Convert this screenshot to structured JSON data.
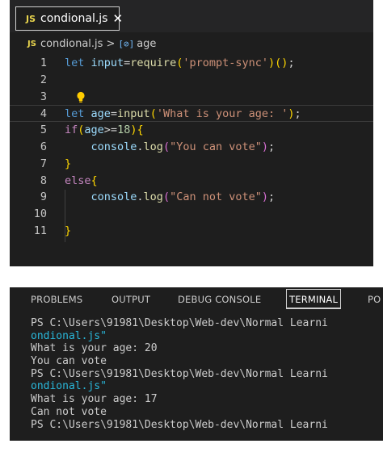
{
  "editor": {
    "tab": {
      "badge": "JS",
      "label": "condional.js",
      "close": "✕"
    },
    "breadcrumb": {
      "badge": "JS",
      "file": "condional.js",
      "separator": ">",
      "symbol_icon": "[⊘]",
      "symbol": "age"
    },
    "lines": [
      {
        "n": "1",
        "tokens": [
          {
            "t": "let ",
            "c": "kw"
          },
          {
            "t": "input",
            "c": "var"
          },
          {
            "t": "=",
            "c": ""
          },
          {
            "t": "require",
            "c": "fn"
          },
          {
            "t": "(",
            "c": "b1"
          },
          {
            "t": "'prompt-sync'",
            "c": "str"
          },
          {
            "t": ")",
            "c": "b1"
          },
          {
            "t": "(",
            "c": "b1"
          },
          {
            "t": ")",
            "c": "b1"
          },
          {
            "t": ";",
            "c": ""
          }
        ]
      },
      {
        "n": "2",
        "tokens": []
      },
      {
        "n": "3",
        "tokens": [],
        "bulb": true
      },
      {
        "n": "4",
        "tokens": [
          {
            "t": "let ",
            "c": "kw"
          },
          {
            "t": "age",
            "c": "var"
          },
          {
            "t": "=",
            "c": ""
          },
          {
            "t": "input",
            "c": "fn"
          },
          {
            "t": "(",
            "c": "b1"
          },
          {
            "t": "'What is your age: '",
            "c": "str"
          },
          {
            "t": ")",
            "c": "b1"
          },
          {
            "t": ";",
            "c": ""
          }
        ],
        "current": true
      },
      {
        "n": "5",
        "tokens": [
          {
            "t": "if",
            "c": "kw2"
          },
          {
            "t": "(",
            "c": "b1"
          },
          {
            "t": "age",
            "c": "var"
          },
          {
            "t": ">=",
            "c": ""
          },
          {
            "t": "18",
            "c": "num"
          },
          {
            "t": ")",
            "c": "b1"
          },
          {
            "t": "{",
            "c": "b1"
          }
        ]
      },
      {
        "n": "6",
        "tokens": [
          {
            "t": "    console",
            "c": "var"
          },
          {
            "t": ".",
            "c": ""
          },
          {
            "t": "log",
            "c": "fn"
          },
          {
            "t": "(",
            "c": "b2"
          },
          {
            "t": "\"You can vote\"",
            "c": "str"
          },
          {
            "t": ")",
            "c": "b2"
          },
          {
            "t": ";",
            "c": ""
          }
        ]
      },
      {
        "n": "7",
        "tokens": [
          {
            "t": "}",
            "c": "b1"
          }
        ]
      },
      {
        "n": "8",
        "tokens": [
          {
            "t": "else",
            "c": "kw2"
          },
          {
            "t": "{",
            "c": "b1"
          }
        ]
      },
      {
        "n": "9",
        "tokens": [
          {
            "t": "    console",
            "c": "var"
          },
          {
            "t": ".",
            "c": ""
          },
          {
            "t": "log",
            "c": "fn"
          },
          {
            "t": "(",
            "c": "b2"
          },
          {
            "t": "\"Can not vote\"",
            "c": "str"
          },
          {
            "t": ")",
            "c": "b2"
          },
          {
            "t": ";",
            "c": ""
          }
        ]
      },
      {
        "n": "10",
        "tokens": []
      },
      {
        "n": "11",
        "tokens": [
          {
            "t": "}",
            "c": "b1"
          }
        ]
      }
    ]
  },
  "terminal": {
    "tabs": {
      "problems": "PROBLEMS",
      "output": "OUTPUT",
      "debug_console": "DEBUG CONSOLE",
      "terminal": "TERMINAL",
      "ports": "PO"
    },
    "lines": [
      {
        "text": "PS C:\\Users\\91981\\Desktop\\Web-dev\\Normal Learni",
        "style": ""
      },
      {
        "text": "ondional.js\"",
        "style": "cyan"
      },
      {
        "text": "What is your age: 20",
        "style": ""
      },
      {
        "text": "You can vote",
        "style": ""
      },
      {
        "text": "PS C:\\Users\\91981\\Desktop\\Web-dev\\Normal Learni",
        "style": ""
      },
      {
        "text": "ondional.js\"",
        "style": "cyan"
      },
      {
        "text": "What is your age: 17",
        "style": ""
      },
      {
        "text": "Can not vote",
        "style": ""
      },
      {
        "text": "PS C:\\Users\\91981\\Desktop\\Web-dev\\Normal Learni",
        "style": ""
      }
    ]
  },
  "colors": {
    "editor_bg": "#1e1e1e",
    "keyword": "#569cd6",
    "control_keyword": "#c586c0",
    "function": "#dcdcaa",
    "variable": "#9cdcfe",
    "string": "#ce9178",
    "number": "#b5cea8",
    "bracket_1": "#ffd700",
    "bracket_2": "#da70d6",
    "js_badge": "#e8d44d"
  }
}
